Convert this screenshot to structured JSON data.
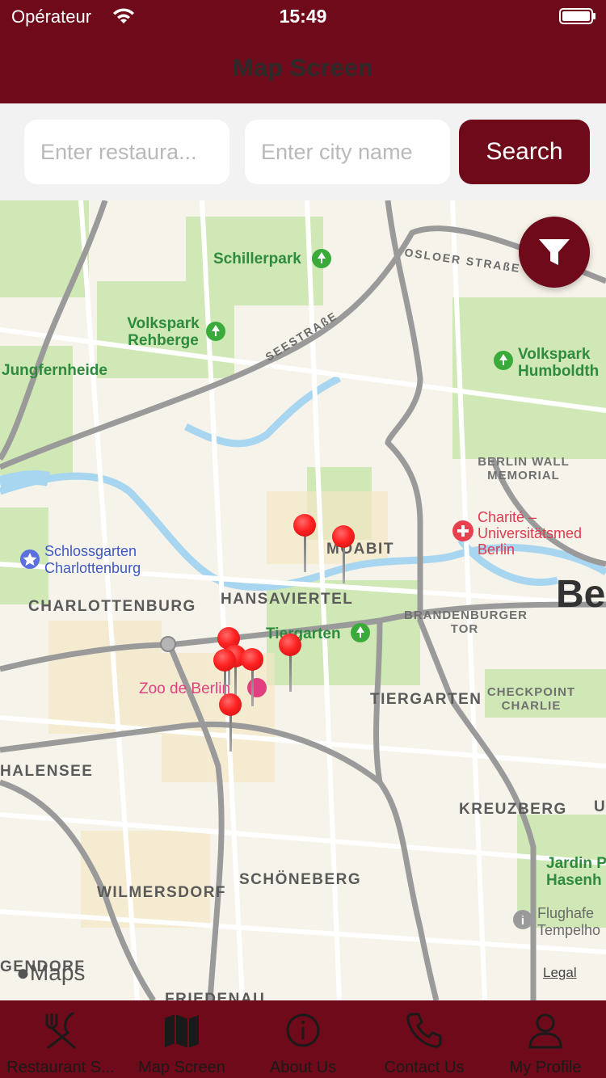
{
  "status": {
    "carrier": "Opérateur",
    "time": "15:49"
  },
  "header": {
    "title": "Map Screen"
  },
  "search": {
    "restaurant_placeholder": "Enter restaura...",
    "city_placeholder": "Enter city name",
    "button_label": "Search"
  },
  "map": {
    "districts": [
      "MOABIT",
      "HANSAVIERTEL",
      "CHARLOTTENBURG",
      "TIERGARTEN",
      "HALENSEE",
      "KREUZBERG",
      "SCHÖNEBERG",
      "WILMERSDORF"
    ],
    "parks": [
      "Schillerpark",
      "Volkspark Rehberge",
      "Jungfernheide",
      "Volkspark Humboldth",
      "Tiergarten",
      "Jardin P Hasenh"
    ],
    "landmarks": [
      "BERLIN WALL MEMORIAL",
      "BRANDENBURGER TOR",
      "CHECKPOINT CHARLIE"
    ],
    "streets": [
      "OSLOER STRAßE",
      "SEESTRAßE"
    ],
    "pois": {
      "charite": "Charité – Universitätsmed Berlin",
      "schlossgarten": "Schlossgarten Charlottenburg",
      "zoo": "Zoo de Berlin",
      "flughafen": "Flughafe Tempelho"
    },
    "city_label": "Be",
    "edge_labels": [
      "GENDORF",
      "FRIEDENAU",
      "U"
    ],
    "attribution": "Maps",
    "legal": "Legal",
    "pin_count": 9
  },
  "tabs": [
    {
      "label": "Restaurant S...",
      "icon": "utensils-icon"
    },
    {
      "label": "Map Screen",
      "icon": "map-icon"
    },
    {
      "label": "About Us",
      "icon": "info-icon"
    },
    {
      "label": "Contact Us",
      "icon": "phone-icon"
    },
    {
      "label": "My Profile",
      "icon": "user-icon"
    }
  ],
  "colors": {
    "brand": "#6e0a19",
    "pin": "#ff2a2a"
  }
}
